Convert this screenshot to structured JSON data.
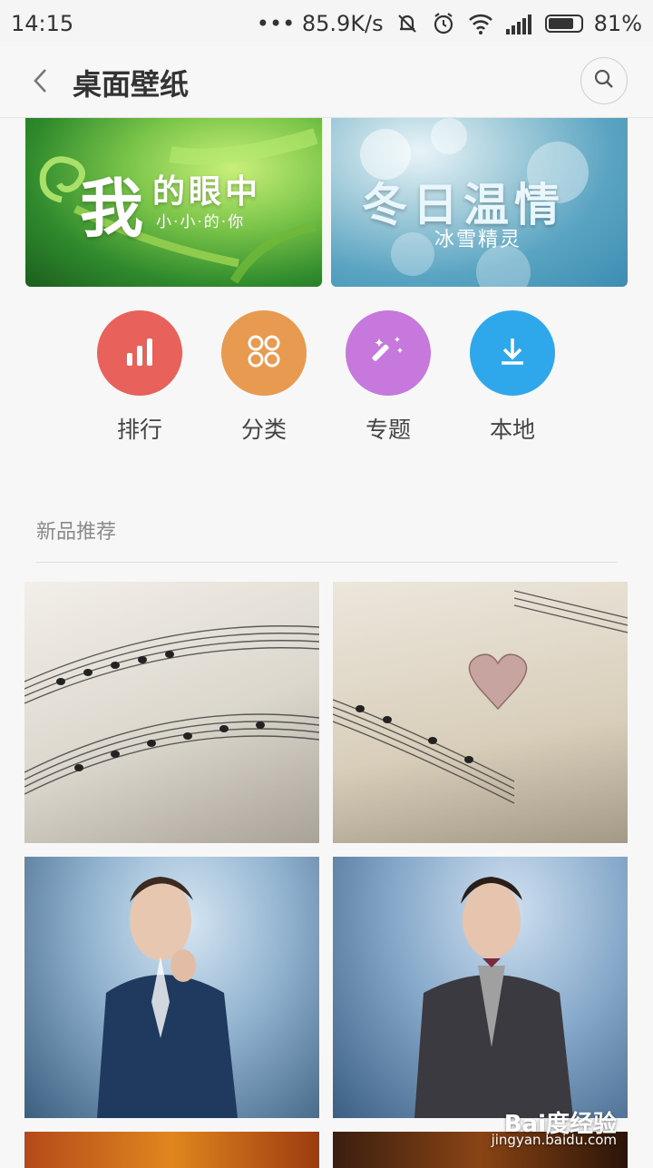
{
  "status_bar": {
    "time": "14:15",
    "network_speed": "••• 85.9K/s",
    "battery_percent": "81%",
    "battery_level": 0.81
  },
  "header": {
    "title": "桌面壁纸",
    "back_icon": "chevron-left-icon",
    "search_icon": "search-icon"
  },
  "banners": [
    {
      "title": "我的眼中",
      "title_big": "我",
      "title_rest": "的眼中",
      "subtitle": "小·小·的·你"
    },
    {
      "title": "冬日温情",
      "subtitle": "冰雪精灵"
    }
  ],
  "quick_actions": [
    {
      "label": "排行",
      "icon": "bar-chart-icon",
      "color": "#e8615b"
    },
    {
      "label": "分类",
      "icon": "grid-circles-icon",
      "color": "#e79a50"
    },
    {
      "label": "专题",
      "icon": "magic-wand-icon",
      "color": "#c678dd"
    },
    {
      "label": "本地",
      "icon": "download-icon",
      "color": "#2ea8ea"
    }
  ],
  "section": {
    "title": "新品推荐"
  },
  "watermark": {
    "brand": "Bai度经验",
    "url": "jingyan.baidu.com"
  }
}
